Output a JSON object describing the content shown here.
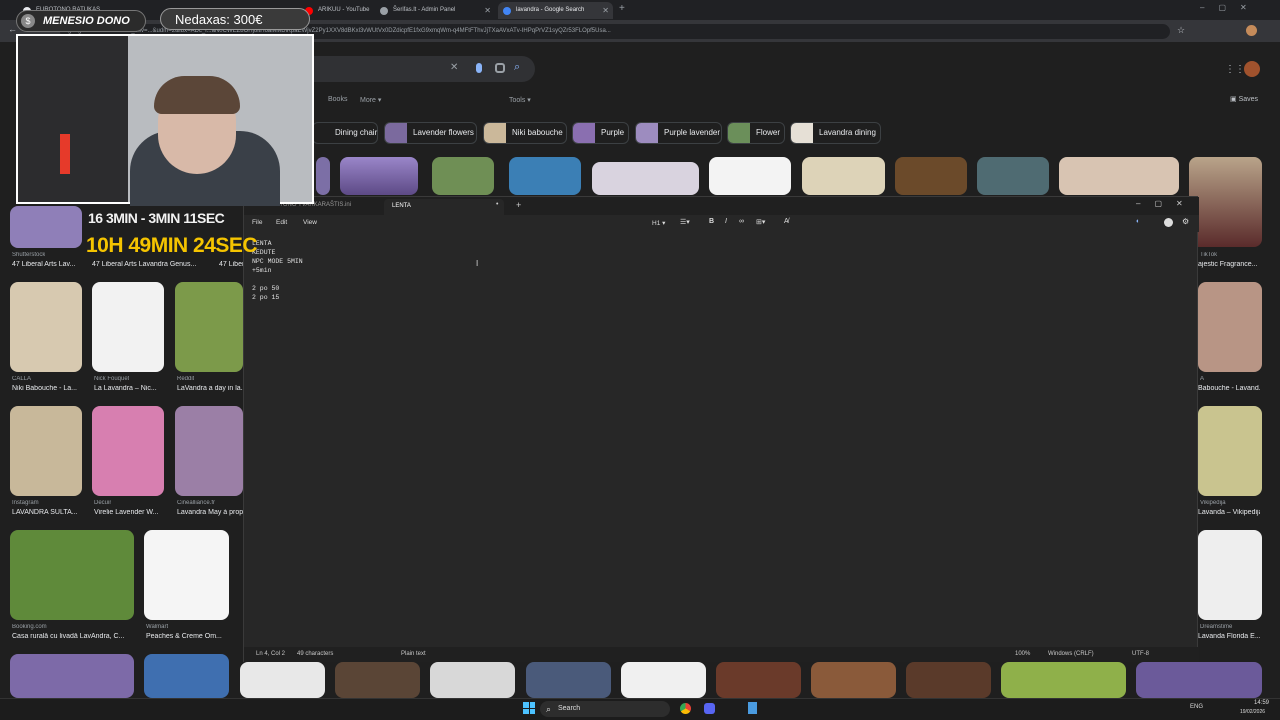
{
  "browser": {
    "tabs": [
      {
        "label": "EUROTONO RATUKAS"
      },
      {
        "label": "ARIKUU - YouTube"
      },
      {
        "label": "Šerifas.lt - Admin Panel"
      },
      {
        "label": "lavandra - Google Search"
      }
    ],
    "url": "google.com/search?sca_esv=...&udm=2&fbx=ADc_l...aN0CWEZ8OHjoltHoaMMDiKpaEWjvZ2Py1XXV8dBKxl3vWUtVx0DZdicpfE1fxG9xmqWm-q4MFtFThvJjTXaAVxATv-IHPqPrVZ1syQZr53FLOpf5Usa..."
  },
  "google": {
    "nav": {
      "books": "Books",
      "more": "More",
      "tools": "Tools",
      "saves": "Saves"
    },
    "chips": [
      "Dining chair",
      "Lavender flowers",
      "Niki babouche",
      "Purple",
      "Purple lavender",
      "Flower",
      "Lavandra dining"
    ],
    "results": [
      {
        "source": "Shutterstock",
        "title": "47 Liberal Arts Lav..."
      },
      {
        "source": "",
        "title": "47 Liberal Arts Lavandra Genus..."
      },
      {
        "source": "",
        "title": "47 Liber..."
      },
      {
        "source": "CALLA",
        "title": "Niki Babouche - La..."
      },
      {
        "source": "Nick Fouquet",
        "title": "La Lavandra – Nic..."
      },
      {
        "source": "Reddit",
        "title": "LaVandra a day in la..."
      },
      {
        "source": "Instagram",
        "title": "LAVANDRA SULTA..."
      },
      {
        "source": "Decuir",
        "title": "Virelie Lavender W..."
      },
      {
        "source": "Cinealliance.fr",
        "title": "Lavandra May à prop..."
      },
      {
        "source": "Booking.com",
        "title": "Casa rurală cu livadă LavAndra, C..."
      },
      {
        "source": "Walmart",
        "title": "Peaches & Creme Om..."
      },
      {
        "source": "TikTok",
        "title": "ajestic Fragrance..."
      },
      {
        "source": "A",
        "title": "Babouche - Lavand..."
      },
      {
        "source": "Vikipedija",
        "title": "Lavanda – Vikipedija"
      },
      {
        "source": "Dreamstime",
        "title": "Lavanda Florida E..."
      }
    ]
  },
  "overlay": {
    "donate_label": "MENESIO DONO",
    "goal_label": "Nedaxas: 300€",
    "timer_small": "16 3MIN - 3MIN 11SEC",
    "timer_big": "10H 49MIN 24SEC"
  },
  "notepad": {
    "tabs": [
      {
        "label": "EUROTONO TVARKARAŠTIS.ini"
      },
      {
        "label": "LENTA"
      }
    ],
    "menu": [
      "File",
      "Edit",
      "View"
    ],
    "heading_btn": "H1",
    "content": "LENTA\nKEDUTE\nNPC MODE 5MIN\n+5min\n\n2 po 50\n2 po 15",
    "status": {
      "position": "Ln 4, Col 2",
      "chars": "49 characters",
      "format": "Plain text",
      "zoom": "100%",
      "eol": "Windows (CRLF)",
      "encoding": "UTF-8"
    }
  },
  "taskbar": {
    "search_label": "Search",
    "lang": "ENG",
    "time": "14:59",
    "date": "19/02/2026"
  },
  "colors": {
    "accent": "#8ab4f8",
    "timer_yellow": "#f5c400"
  }
}
